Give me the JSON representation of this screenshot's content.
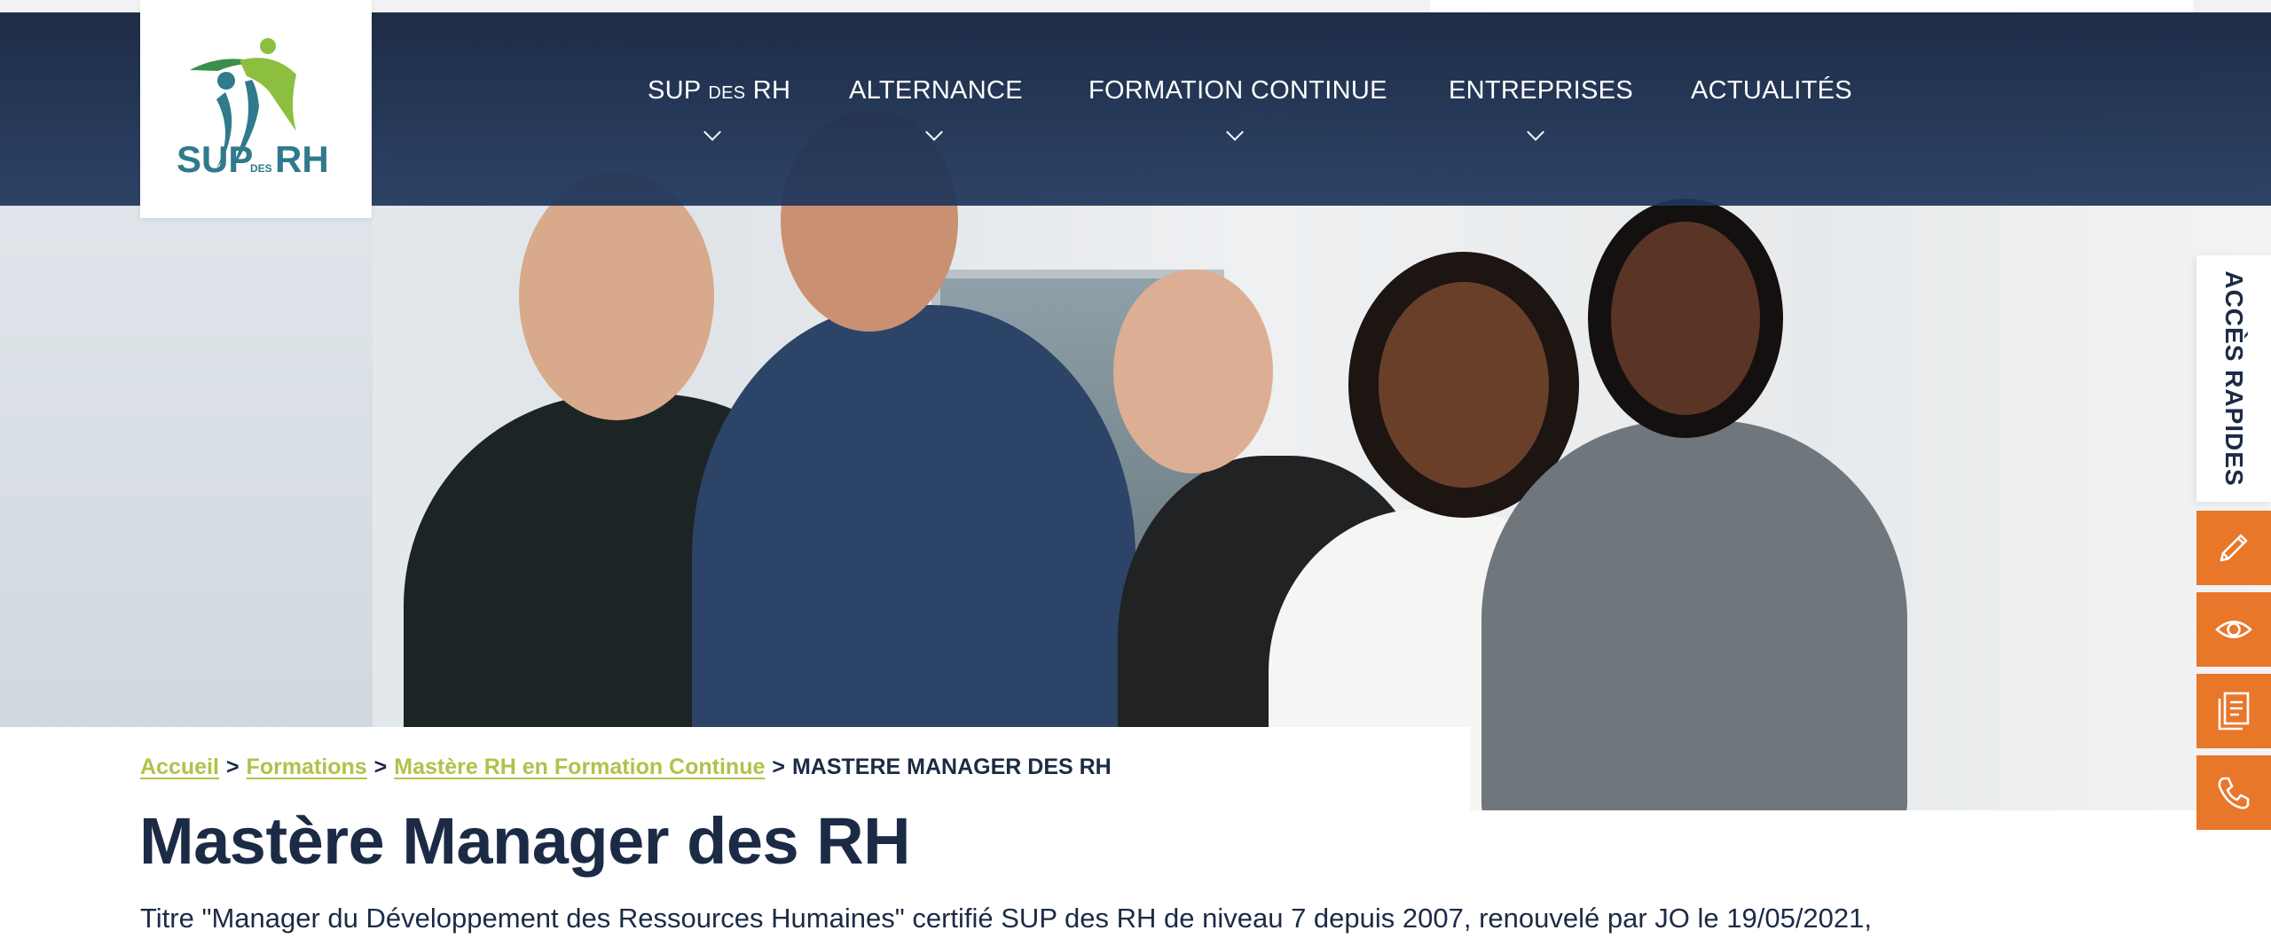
{
  "header": {
    "logo": {
      "text_sup": "SUP",
      "text_des": "DES",
      "text_rh": "RH",
      "alt": "SUP des RH"
    },
    "nav": [
      {
        "label_main": "SUP",
        "label_small": "DES",
        "label_end": "RH",
        "has_dropdown": true
      },
      {
        "label": "ALTERNANCE",
        "has_dropdown": true
      },
      {
        "label": "FORMATION CONTINUE",
        "has_dropdown": true
      },
      {
        "label": "ENTREPRISES",
        "has_dropdown": true
      },
      {
        "label": "ACTUALITÉS",
        "has_dropdown": false
      }
    ]
  },
  "hero": {
    "image": "group-of-smiling-professionals-photo"
  },
  "quick_access": {
    "label": "ACCÈS RAPIDES",
    "buttons": [
      {
        "icon": "pencil-icon"
      },
      {
        "icon": "eye-icon"
      },
      {
        "icon": "document-icon"
      },
      {
        "icon": "phone-icon"
      }
    ]
  },
  "breadcrumb": {
    "items": [
      "Accueil",
      "Formations",
      "Mastère RH en Formation Continue"
    ],
    "separator": ">",
    "current": "MASTERE MANAGER DES RH"
  },
  "page": {
    "title": "Mastère Manager des RH",
    "subtitle": "Titre \"Manager du Développement des Ressources Humaines\" certifié SUP des RH de niveau 7 depuis 2007, renouvelé par JO le 19/05/2021,"
  },
  "colors": {
    "navy": "#1c2b45",
    "accent_green": "#b4c04a",
    "accent_orange": "#e8772a",
    "logo_teal": "#2f7a8c",
    "logo_green": "#8cbf3f"
  }
}
